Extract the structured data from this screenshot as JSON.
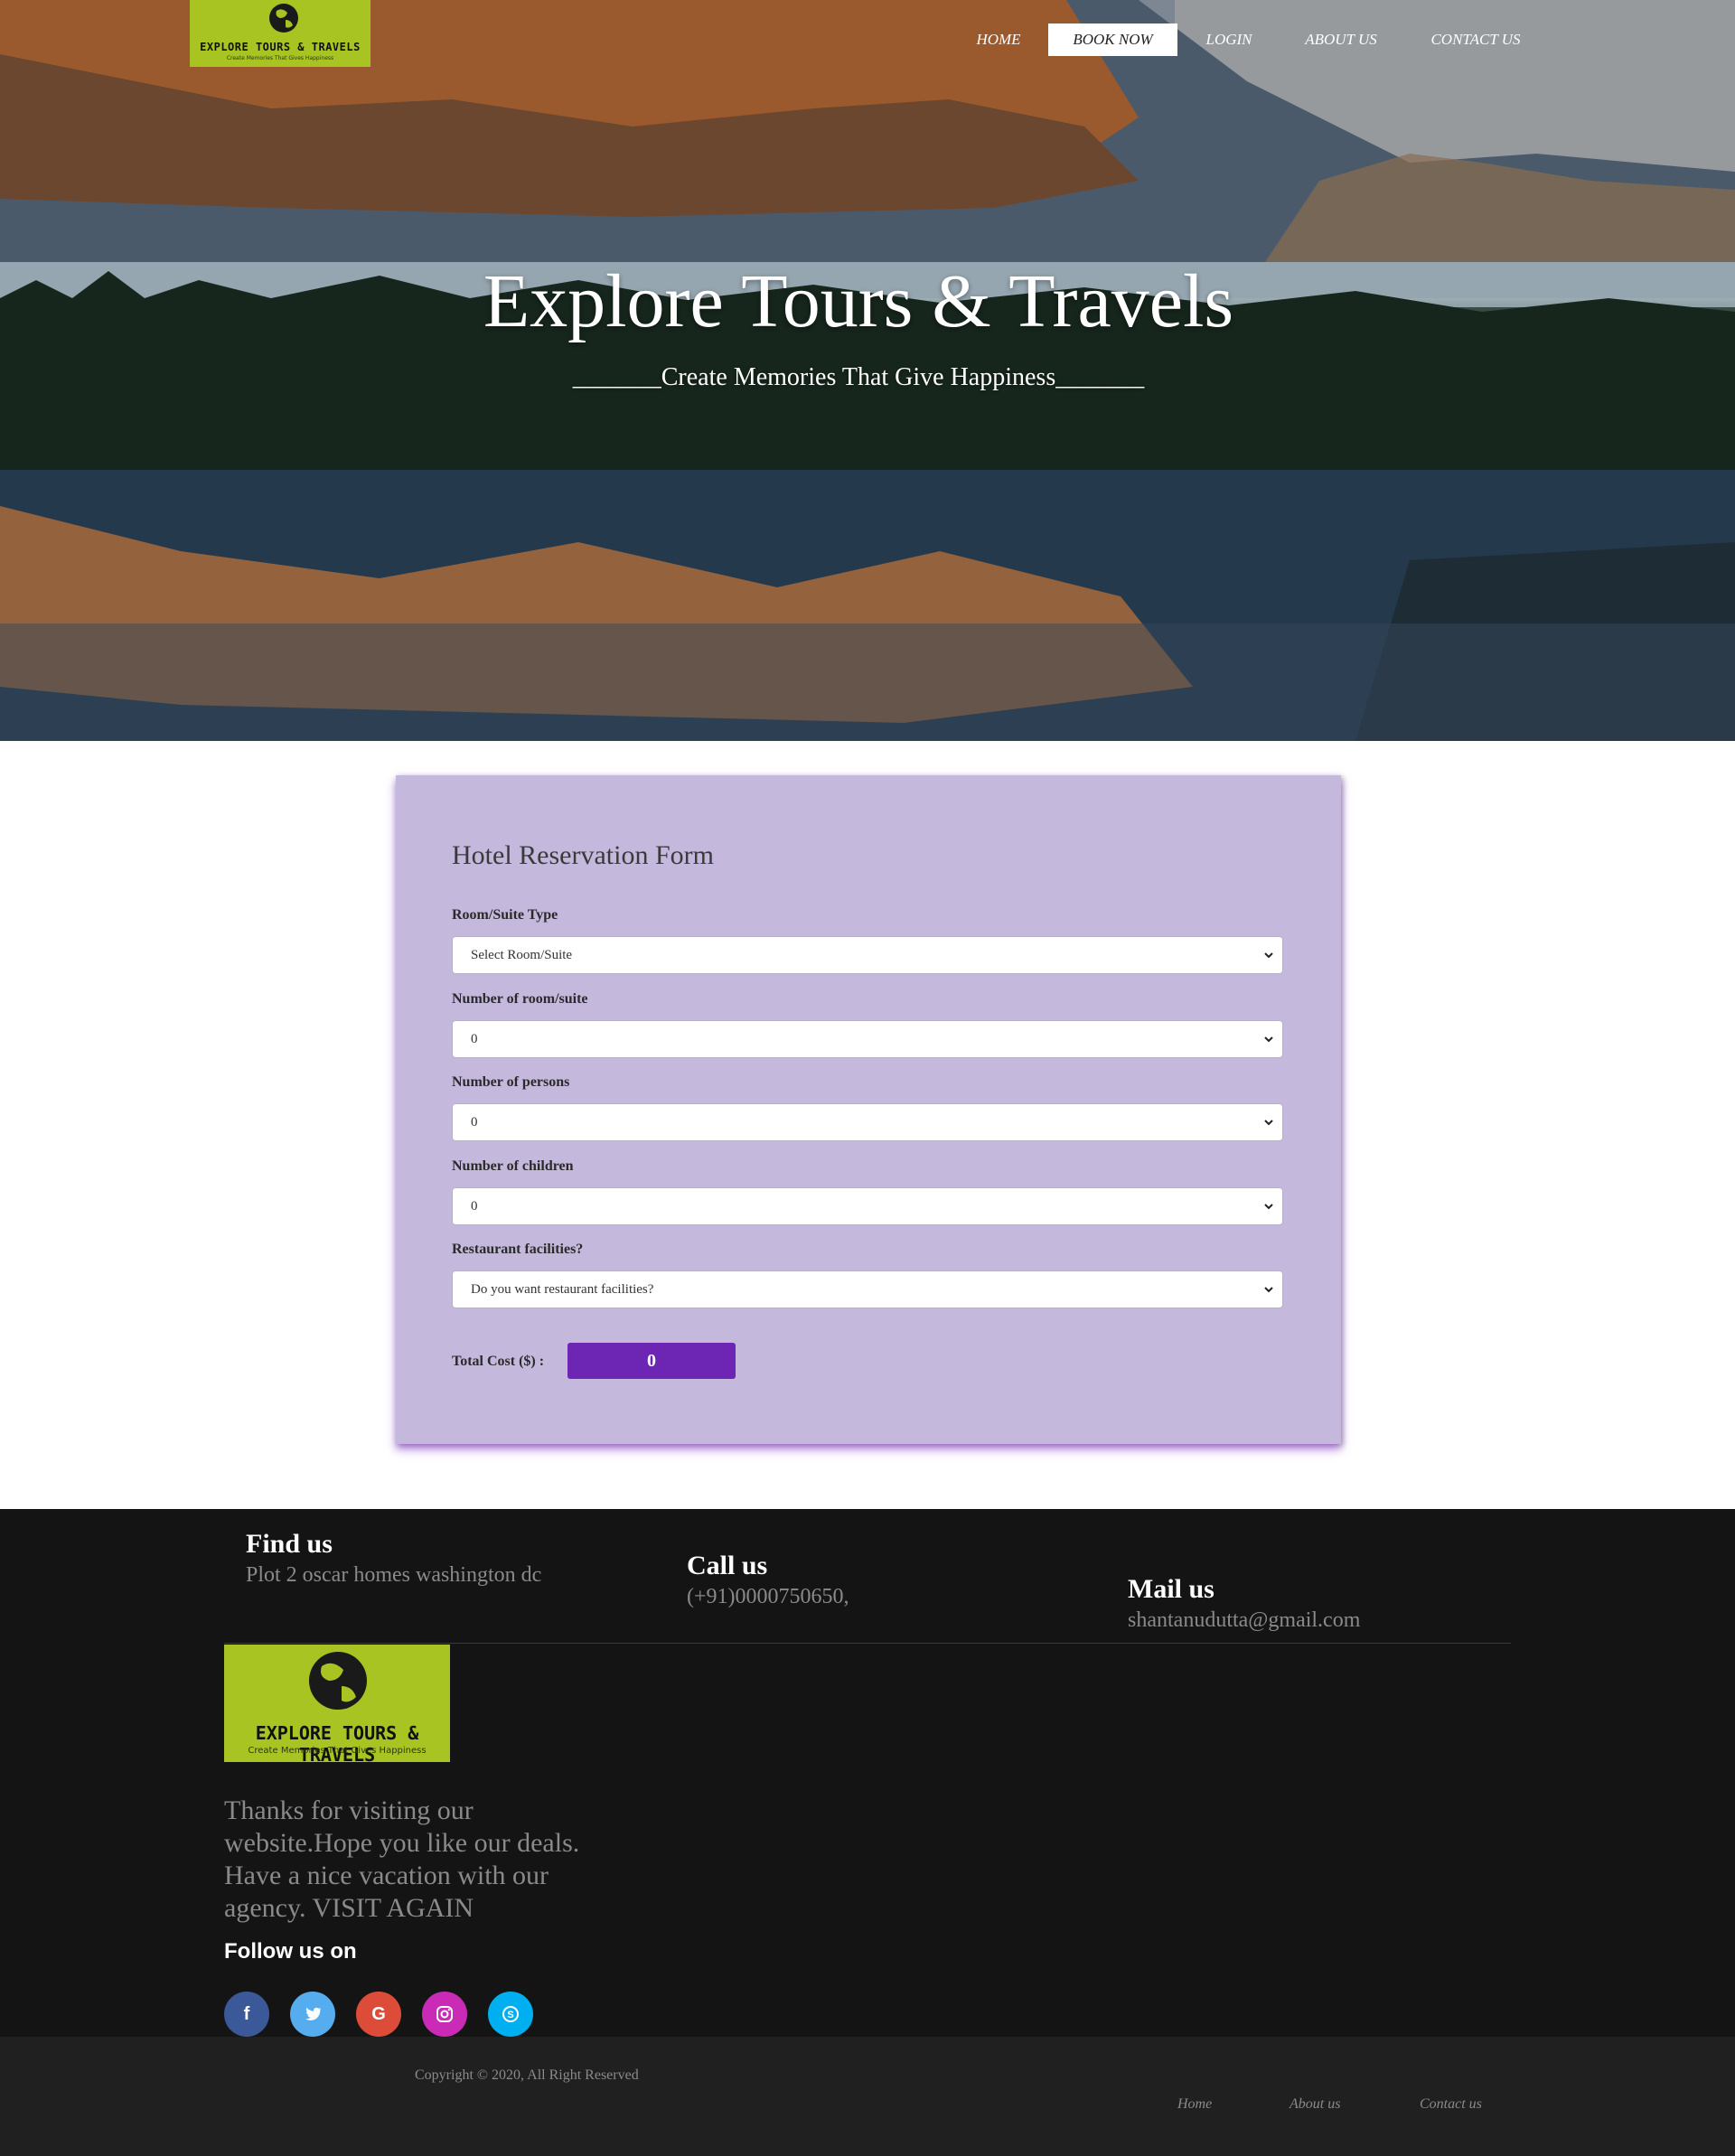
{
  "brand": {
    "name": "EXPLORE TOURS & TRAVELS",
    "tagline": "Create Memories That Gives Happiness"
  },
  "nav": {
    "items": [
      {
        "label": "HOME",
        "active": false
      },
      {
        "label": "BOOK NOW",
        "active": true
      },
      {
        "label": "LOGIN",
        "active": false
      },
      {
        "label": "ABOUT US",
        "active": false
      },
      {
        "label": "CONTACT US",
        "active": false
      }
    ]
  },
  "hero": {
    "title": "Explore Tours & Travels",
    "subtitle": "_______Create Memories That Give Happiness_______"
  },
  "form": {
    "title": "Hotel Reservation Form",
    "fields": [
      {
        "label": "Room/Suite Type",
        "value": "Select Room/Suite"
      },
      {
        "label": "Number of room/suite",
        "value": "0"
      },
      {
        "label": "Number of persons",
        "value": "0"
      },
      {
        "label": "Number of children",
        "value": "0"
      },
      {
        "label": "Restaurant facilities?",
        "value": "Do you want restaurant facilities?"
      }
    ],
    "total_label": "Total Cost ($) :",
    "total_value": "0"
  },
  "footer": {
    "find_us": {
      "title": "Find us",
      "text": "Plot 2 oscar homes washington dc"
    },
    "call_us": {
      "title": "Call us",
      "text": "(+91)0000750650,"
    },
    "mail_us": {
      "title": "Mail us",
      "text": "shantanudutta@gmail.com"
    },
    "thanks_text": "Thanks for visiting our website.Hope you like our deals. Have a nice vacation with our agency. VISIT AGAIN",
    "follow_label": "Follow us on",
    "social": [
      {
        "icon": "facebook-icon",
        "glyph": "f",
        "color": "#3b5998"
      },
      {
        "icon": "twitter-icon",
        "glyph": "🐦",
        "color": "#55acee"
      },
      {
        "icon": "google-icon",
        "glyph": "G",
        "color": "#dd4b39"
      },
      {
        "icon": "instagram-icon",
        "glyph": "◎",
        "color": "#c92bb7"
      },
      {
        "icon": "skype-icon",
        "glyph": "S",
        "color": "#00aff0"
      }
    ],
    "copyright": "Copyright © 2020, All Right Reserved",
    "links": [
      "Home",
      "About us",
      "Contact us"
    ]
  },
  "colors": {
    "logo_green": "#a8c423",
    "form_bg": "#c5b8dd",
    "total_purple": "#6d26b3",
    "footer_bg": "#151414"
  }
}
